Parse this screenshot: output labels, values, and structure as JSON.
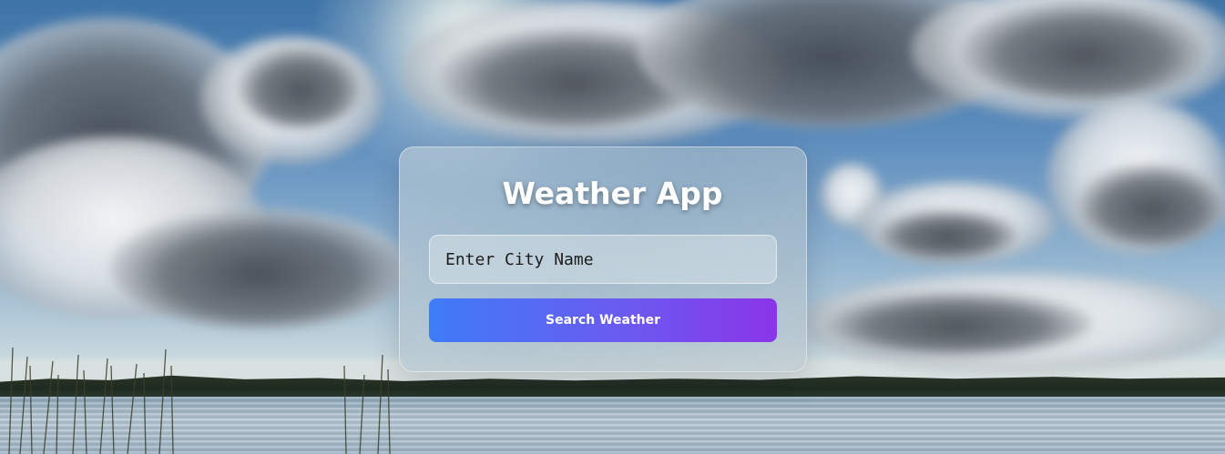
{
  "app": {
    "title": "Weather App"
  },
  "search": {
    "placeholder": "Enter City Name",
    "value": "",
    "button_label": "Search Weather"
  },
  "theme": {
    "button_gradient_start": "#3f7cf7",
    "button_gradient_end": "#8a35e8",
    "title_color": "#ffffff"
  },
  "background": {
    "description_icon": "sky-lake-background"
  }
}
